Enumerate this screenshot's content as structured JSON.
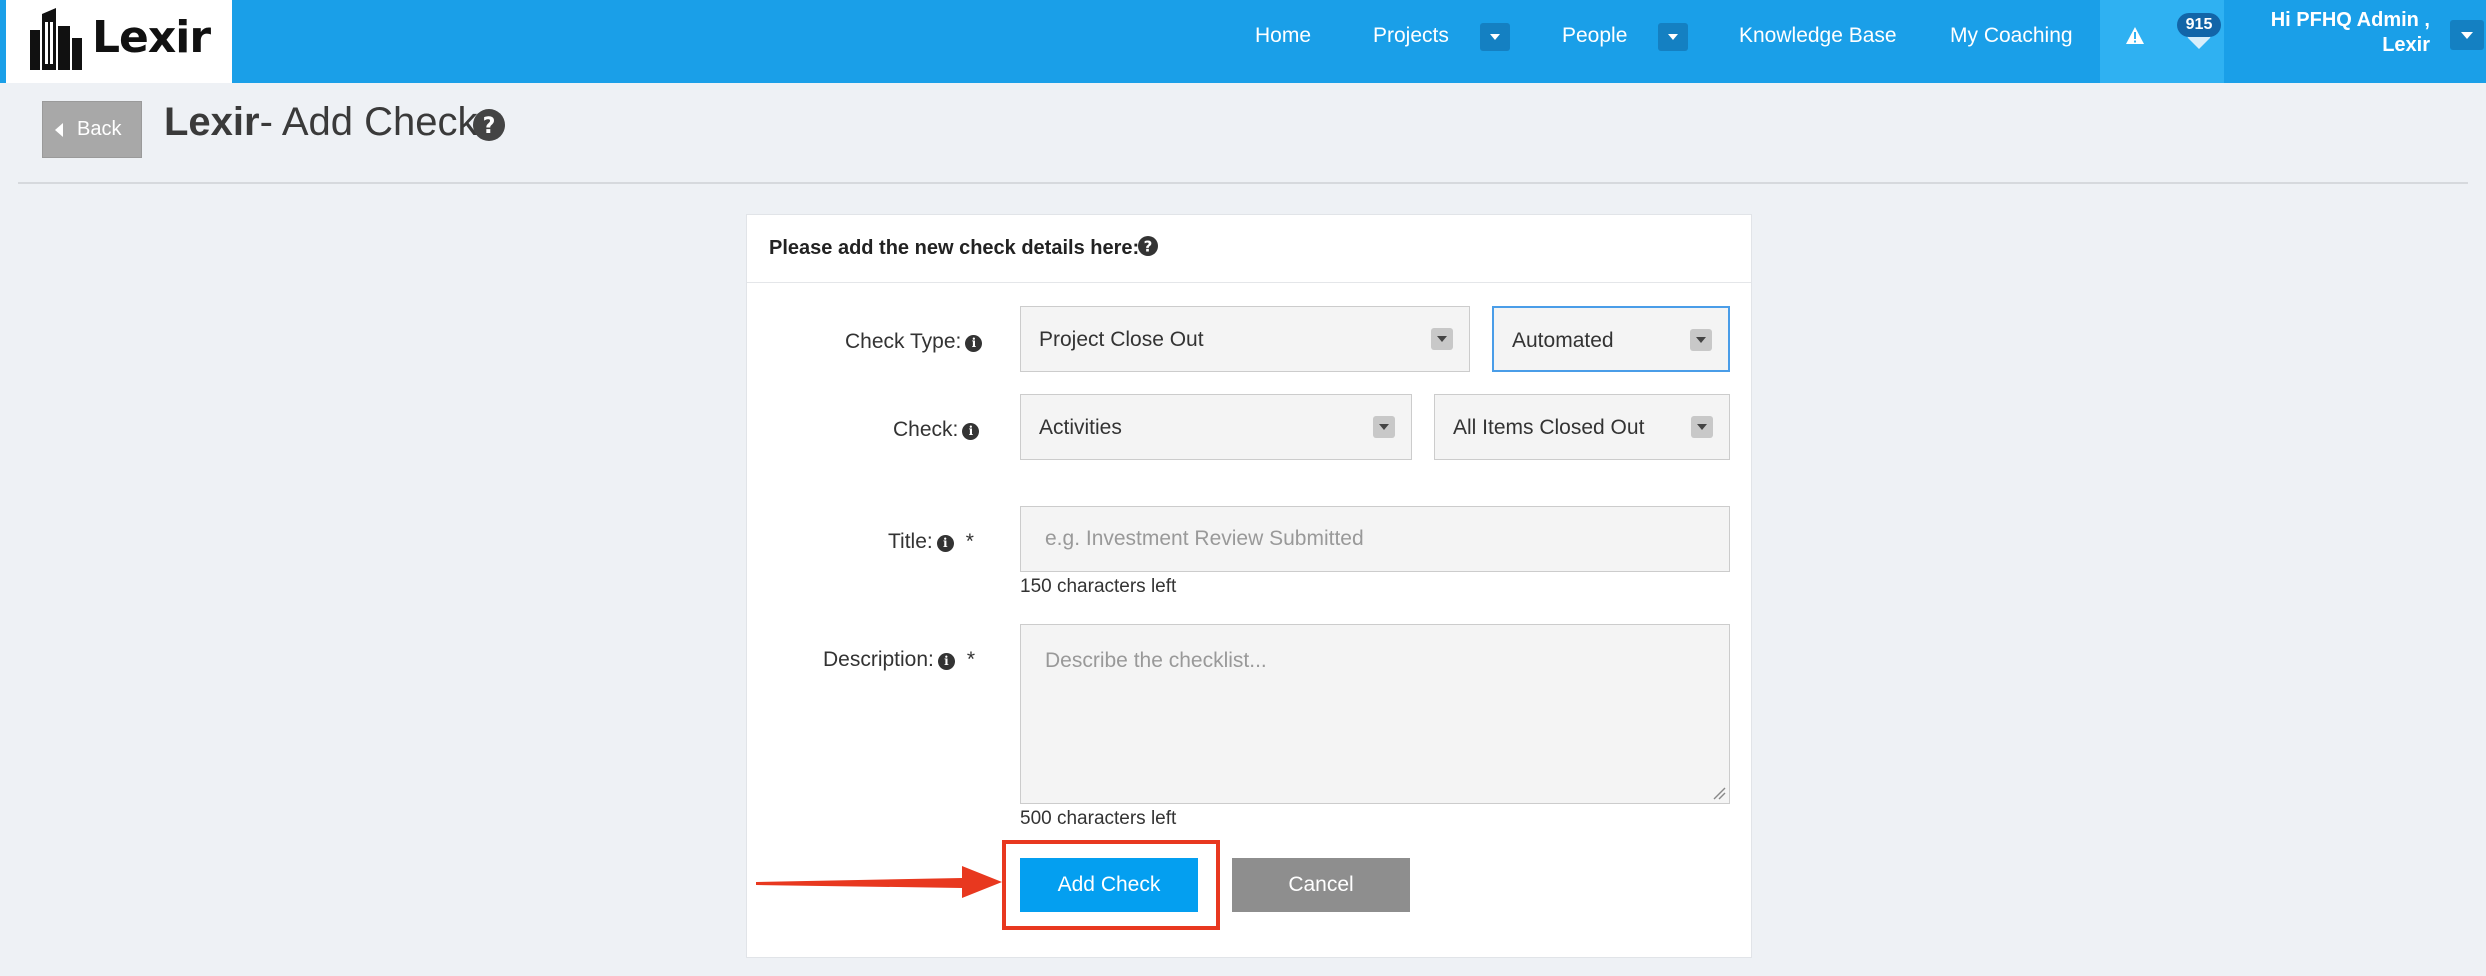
{
  "brand": {
    "logo_text": "Lexir"
  },
  "nav": {
    "home": "Home",
    "projects": "Projects",
    "people": "People",
    "knowledge_base": "Knowledge Base",
    "my_coaching": "My Coaching",
    "notification_count": "915",
    "user_greeting": "Hi PFHQ Admin ,",
    "user_org": "Lexir"
  },
  "header": {
    "back_label": "Back",
    "title_bold": "Lexir",
    "title_rest": "- Add Check"
  },
  "form": {
    "heading": "Please add the new check details here:",
    "check_type_label": "Check Type:",
    "check_type_value": "Project Close Out",
    "check_mode_value": "Automated",
    "check_label": "Check:",
    "check_value": "Activities",
    "check_criteria_value": "All Items Closed Out",
    "title_label": "Title:",
    "required_mark": "*",
    "title_placeholder": "e.g. Investment Review Submitted",
    "title_hint": "150 characters left",
    "description_label": "Description:",
    "description_placeholder": "Describe the checklist...",
    "description_hint": "500 characters left",
    "submit_label": "Add Check",
    "cancel_label": "Cancel"
  },
  "colors": {
    "nav_bg": "#1a9fe8",
    "primary_button": "#049ff0",
    "secondary_button": "#8e8e8e",
    "highlight": "#e8381f"
  },
  "icons": [
    "building-logo-icon",
    "warning-icon",
    "heart-icon",
    "help-icon",
    "info-icon",
    "caret-down-icon",
    "arrow-icon"
  ]
}
